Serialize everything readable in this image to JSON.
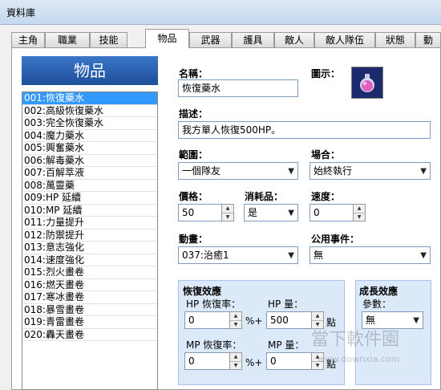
{
  "window": {
    "title": "資料庫"
  },
  "tabs": [
    "主角",
    "職業",
    "技能",
    "物品",
    "武器",
    "護具",
    "敵人",
    "敵人隊伍",
    "狀態",
    "動"
  ],
  "list": {
    "header": "物品",
    "items": [
      "001:恢復藥水",
      "002:高級恢復藥水",
      "003:完全恢復藥水",
      "004:魔力藥水",
      "005:興奮藥水",
      "006:解毒藥水",
      "007:百解萃液",
      "008:萬靈藥",
      "009:HP 延續",
      "010:MP 延續",
      "011:力量提升",
      "012:防禦提升",
      "013:意志強化",
      "014:速度強化",
      "015:烈火畫卷",
      "016:燃天畫卷",
      "017:寒冰畫卷",
      "018:暴雪畫卷",
      "019:青雷畫卷",
      "020:轟天畫卷"
    ]
  },
  "form": {
    "name_label": "名稱：",
    "name_value": "恢復藥水",
    "icon_label": "圖示：",
    "desc_label": "描述：",
    "desc_value": "我方單人恢復500HP。",
    "scope_label": "範圍：",
    "scope_value": "一個隊友",
    "occasion_label": "場合：",
    "occasion_value": "始終執行",
    "price_label": "價格：",
    "price_value": "50",
    "consumable_label": "消耗品：",
    "consumable_value": "是",
    "speed_label": "速度：",
    "speed_value": "0",
    "animation_label": "動畫：",
    "animation_value": "037:治癒1",
    "common_event_label": "公用事件：",
    "common_event_value": "無"
  },
  "recovery": {
    "title": "恢復效應",
    "hp_rate_label": "HP 恢復率：",
    "hp_rate_value": "0",
    "hp_amount_label": "HP 量：",
    "hp_amount_value": "500",
    "mp_rate_label": "MP 恢復率：",
    "mp_rate_value": "0",
    "mp_amount_label": "MP 量：",
    "mp_amount_value": "0",
    "percent_plus": "%+",
    "points": "點"
  },
  "growth": {
    "title": "成長效應",
    "param_label": "參數：",
    "param_value": "無"
  },
  "watermark": {
    "text": "當下軟件園",
    "url": "www.downxia.com"
  },
  "colors": {
    "selected": "#3399ff",
    "header": "#1e4f9a"
  }
}
